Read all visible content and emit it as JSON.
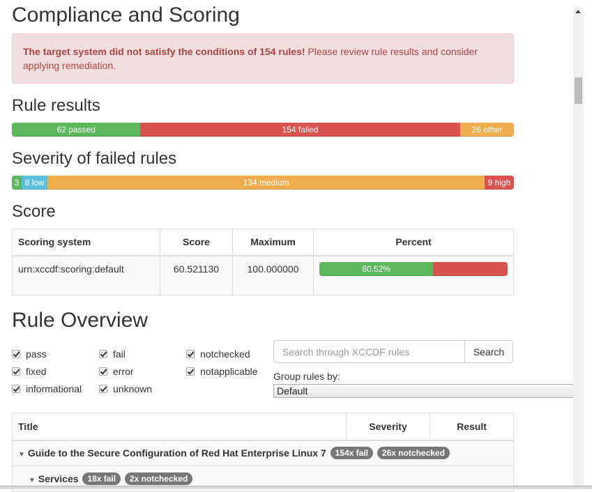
{
  "compliance": {
    "title": "Compliance and Scoring",
    "alert_bold": "The target system did not satisfy the conditions of 154 rules!",
    "alert_text": " Please review rule results and consider applying remediation."
  },
  "rule_results": {
    "title": "Rule results",
    "passed": {
      "count": 62,
      "label": "62 passed",
      "color": "#5cb85c"
    },
    "failed": {
      "count": 154,
      "label": "154 failed",
      "color": "#d9534f"
    },
    "other": {
      "count": 26,
      "label": "26 other",
      "color": "#f0ad4e"
    }
  },
  "severity": {
    "title": "Severity of failed rules",
    "unknown": {
      "count": 3,
      "label": "3",
      "color": "#5cb85c"
    },
    "low": {
      "count": 8,
      "label": "8 low",
      "color": "#5bc0de"
    },
    "medium": {
      "count": 134,
      "label": "134 medium",
      "color": "#f0ad4e"
    },
    "high": {
      "count": 9,
      "label": "9 high",
      "color": "#d9534f"
    }
  },
  "score": {
    "title": "Score",
    "headers": [
      "Scoring system",
      "Score",
      "Maximum",
      "Percent"
    ],
    "row": {
      "system": "urn:xccdf:scoring:default",
      "score": "60.521130",
      "maximum": "100.000000",
      "percent_label": "60.52%",
      "percent_value": 60.52
    }
  },
  "overview": {
    "title": "Rule Overview",
    "filters": [
      {
        "label": "pass",
        "checked": true
      },
      {
        "label": "fixed",
        "checked": true
      },
      {
        "label": "informational",
        "checked": true
      },
      {
        "label": "fail",
        "checked": true
      },
      {
        "label": "error",
        "checked": true
      },
      {
        "label": "unknown",
        "checked": true
      },
      {
        "label": "notchecked",
        "checked": true
      },
      {
        "label": "notapplicable",
        "checked": true
      }
    ],
    "search_placeholder": "Search through XCCDF rules",
    "search_button": "Search",
    "group_label": "Group rules by:",
    "group_value": "Default"
  },
  "rules_table": {
    "headers": [
      "Title",
      "Severity",
      "Result"
    ],
    "rows": [
      {
        "title": "Guide to the Secure Configuration of Red Hat Enterprise Linux 7",
        "badges": [
          "154x fail",
          "26x notchecked"
        ]
      },
      {
        "title": "Services",
        "badges": [
          "18x fail",
          "2x notchecked"
        ]
      }
    ]
  }
}
